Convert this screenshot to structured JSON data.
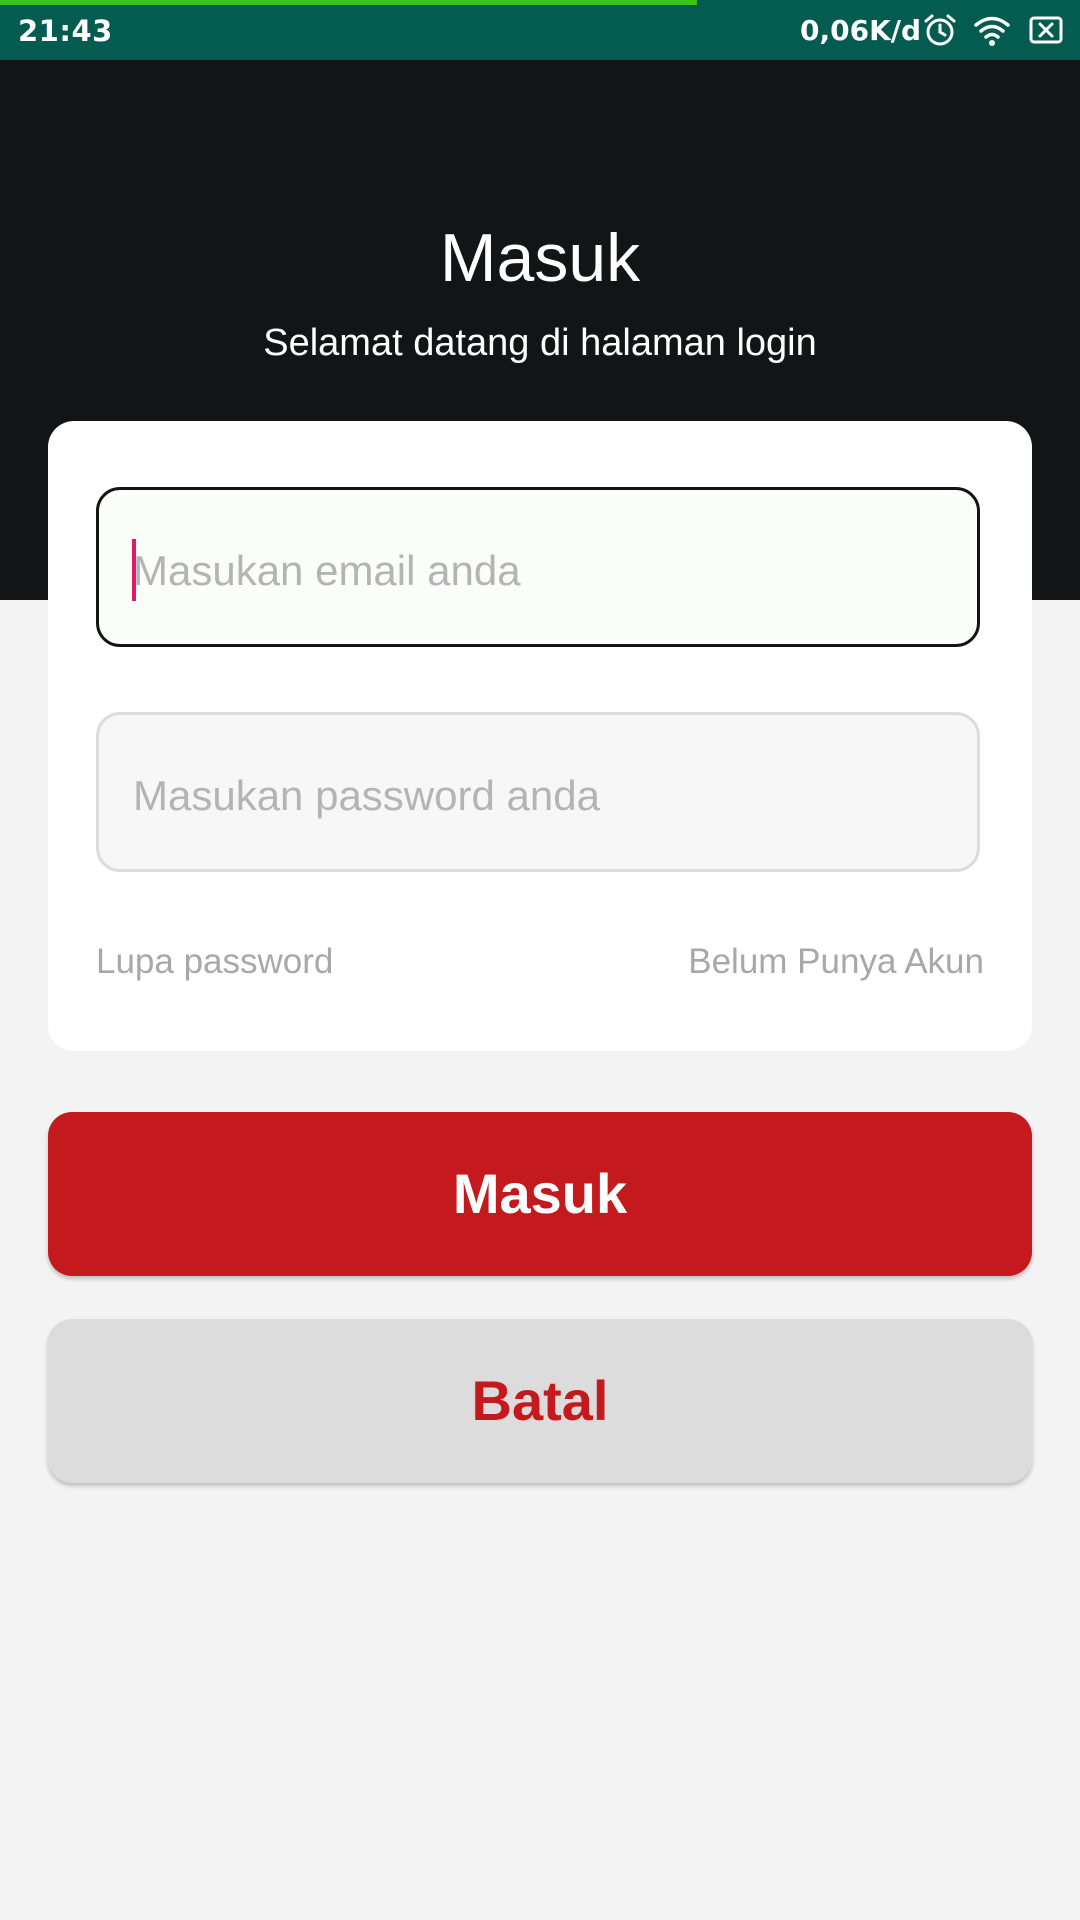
{
  "status_bar": {
    "time": "21:43",
    "network_speed": "0,06K/d",
    "icons": [
      "alarm-icon",
      "wifi-icon",
      "sim-icon"
    ],
    "background_color": "#035c4f",
    "progress_color": "#38c21c"
  },
  "header": {
    "title": "Masuk",
    "subtitle": "Selamat datang di halaman login",
    "background_color": "#131416"
  },
  "form": {
    "email_placeholder": "Masukan email anda",
    "password_placeholder": "Masukan password anda",
    "forgot_password": "Lupa password",
    "no_account": "Belum Punya Akun"
  },
  "actions": {
    "login_label": "Masuk",
    "cancel_label": "Batal",
    "accent_color": "#c4191d"
  }
}
